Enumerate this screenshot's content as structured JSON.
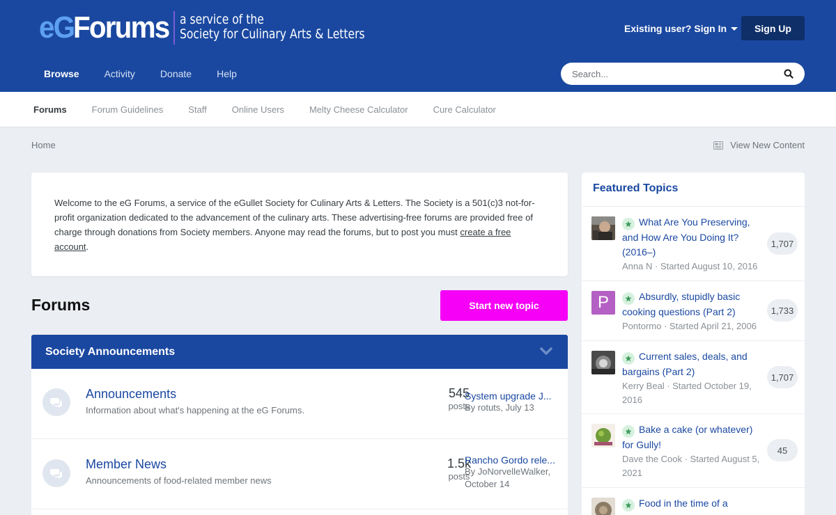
{
  "header": {
    "logo_eg": "eG",
    "logo_forums": "Forums",
    "logo_tag_line1": "a service of the",
    "logo_tag_line2": "Society for Culinary Arts & Letters",
    "signin_label": "Existing user? Sign In",
    "signup_label": "Sign Up",
    "search_placeholder": "Search...",
    "nav": [
      "Browse",
      "Activity",
      "Donate",
      "Help"
    ],
    "active_nav": "Browse"
  },
  "subnav": {
    "items": [
      "Forums",
      "Forum Guidelines",
      "Staff",
      "Online Users",
      "Melty Cheese Calculator",
      "Cure Calculator"
    ],
    "active": "Forums"
  },
  "breadcrumb": {
    "home": "Home",
    "view_new": "View New Content"
  },
  "welcome": {
    "text": "Welcome to the eG Forums, a service of the eGullet Society for Culinary Arts & Letters. The Society is a 501(c)3 not-for-profit organization dedicated to the advancement of the culinary arts. These advertising-free forums are provided free of charge through donations from Society members. Anyone may read the forums, but to post you must ",
    "link": "create a free account",
    "tail": "."
  },
  "forums": {
    "title": "Forums",
    "new_topic_label": "Start new topic",
    "category": "Society Announcements",
    "rows": [
      {
        "name": "Announcements",
        "description": "Information about what's happening at the eG Forums.",
        "count": "545",
        "count_label": "posts",
        "last_title": "System upgrade J...",
        "last_meta": "By rotuts, July 13"
      },
      {
        "name": "Member News",
        "description": "Announcements of food-related member news",
        "count": "1.5k",
        "count_label": "posts",
        "last_title": "Rancho Gordo rele...",
        "last_meta": "By JoNorvelleWalker, October 14"
      }
    ]
  },
  "featured": {
    "title": "Featured Topics",
    "items": [
      {
        "title": "What Are You Preserving, and How Are You Doing It? (2016–)",
        "meta": "Anna N · Started August 10, 2016",
        "count": "1,707",
        "avatar": "photo-1"
      },
      {
        "title": "Absurdly, stupidly basic cooking questions (Part 2)",
        "meta": "Pontormo · Started April 21, 2006",
        "count": "1,733",
        "avatar_letter": "P"
      },
      {
        "title": "Current sales, deals, and bargains (Part 2)",
        "meta": "Kerry Beal · Started October 19, 2016",
        "count": "1,707",
        "avatar": "photo-3"
      },
      {
        "title": "Bake a cake (or whatever) for Gully!",
        "meta": "Dave the Cook · Started August 5, 2021",
        "count": "45",
        "avatar": "photo-4"
      },
      {
        "title": "Food in the time of a",
        "meta": "",
        "count": "",
        "avatar": "photo-5"
      }
    ]
  },
  "colors": {
    "brand": "#1a48a0",
    "accent_button": "#f700f7",
    "signup_bg": "#0e2f68"
  }
}
